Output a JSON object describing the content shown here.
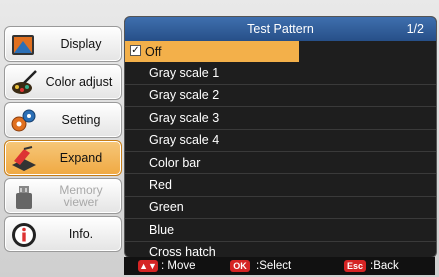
{
  "sidebar": {
    "items": [
      {
        "label": "Display",
        "icon": "display-icon",
        "state": "normal"
      },
      {
        "label": "Color adjust",
        "icon": "color-adjust-icon",
        "state": "normal"
      },
      {
        "label": "Setting",
        "icon": "setting-icon",
        "state": "normal"
      },
      {
        "label": "Expand",
        "icon": "expand-icon",
        "state": "active"
      },
      {
        "label": "Memory viewer",
        "icon": "memory-viewer-icon",
        "state": "disabled"
      },
      {
        "label": "Info.",
        "icon": "info-icon",
        "state": "normal"
      }
    ]
  },
  "panel": {
    "title": "Test Pattern",
    "page": "1/2",
    "items": [
      {
        "label": "Off",
        "checked": true,
        "selected": true
      },
      {
        "label": "Gray scale 1"
      },
      {
        "label": "Gray scale 2"
      },
      {
        "label": "Gray scale 3"
      },
      {
        "label": "Gray scale 4"
      },
      {
        "label": "Color bar"
      },
      {
        "label": "Red"
      },
      {
        "label": "Green"
      },
      {
        "label": "Blue"
      },
      {
        "label": "Cross hatch"
      }
    ]
  },
  "footer": {
    "move_key": "▲▼",
    "move_label": ": Move",
    "select_key": "OK",
    "select_label": ":Select",
    "back_key": "Esc",
    "back_label": ":Back"
  },
  "colors": {
    "header": "#2f5f9c",
    "highlight": "#f3b04a",
    "key": "#d52424"
  }
}
